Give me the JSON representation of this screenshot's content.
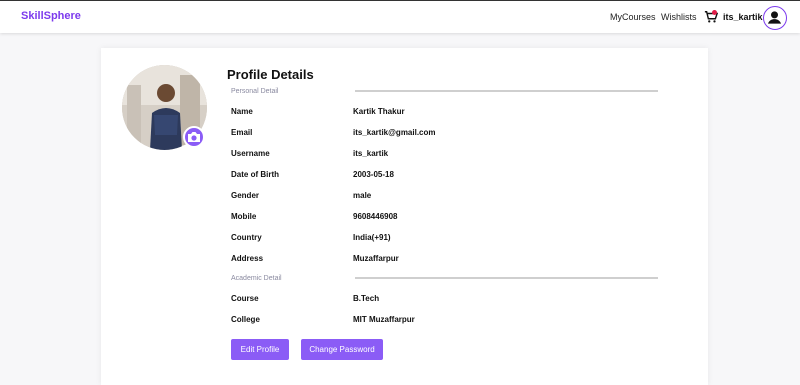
{
  "navbar": {
    "brand": "SkillSphere",
    "links": [
      "MyCourses",
      "Wishlists"
    ],
    "username": "its_kartik"
  },
  "profile": {
    "title": "Profile Details",
    "personal_label": "Personal Detail",
    "academic_label": "Academic Detail",
    "personal": [
      {
        "key": "Name",
        "value": "Kartik Thakur"
      },
      {
        "key": "Email",
        "value": "its_kartik@gmail.com"
      },
      {
        "key": "Username",
        "value": "its_kartik"
      },
      {
        "key": "Date of Birth",
        "value": "2003-05-18"
      },
      {
        "key": "Gender",
        "value": "male"
      },
      {
        "key": "Mobile",
        "value": "9608446908"
      },
      {
        "key": "Country",
        "value": "India(+91)"
      },
      {
        "key": "Address",
        "value": "Muzaffarpur"
      }
    ],
    "academic": [
      {
        "key": "Course",
        "value": "B.Tech"
      },
      {
        "key": "College",
        "value": "MIT Muzaffarpur"
      }
    ],
    "buttons": {
      "edit": "Edit Profile",
      "change_password": "Change Password"
    }
  },
  "colors": {
    "accent": "#8b5cf6",
    "brand": "#7c3aed",
    "badge": "#e11d48"
  },
  "icons": [
    "cart-icon",
    "user-icon",
    "camera-icon"
  ]
}
